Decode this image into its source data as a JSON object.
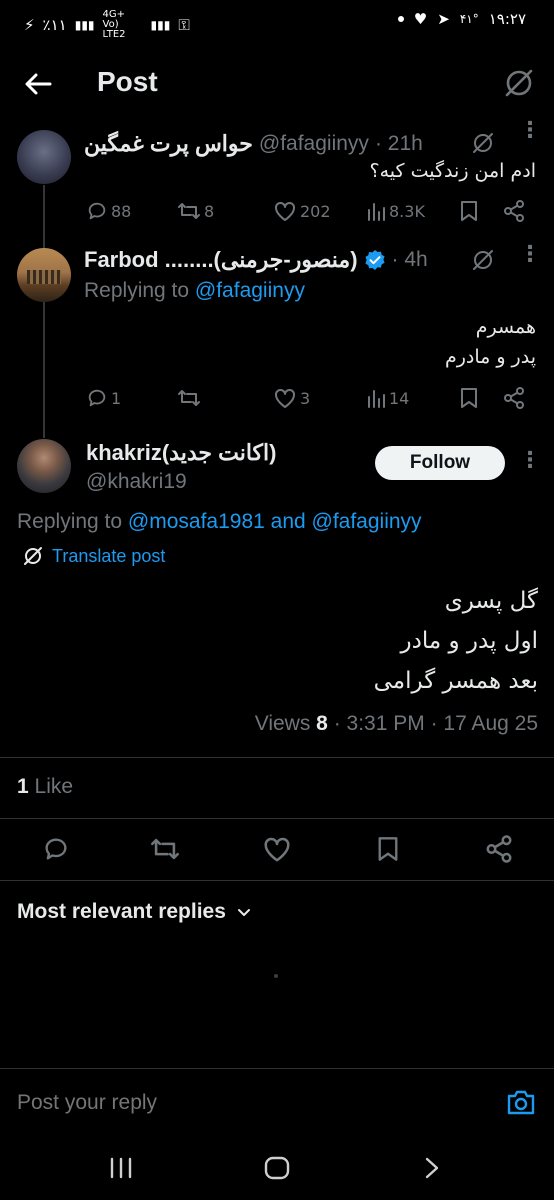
{
  "status_bar": {
    "left_text": "٪۱۱",
    "network": "4G+ Vo) LTE2",
    "right_temp": "۴۱°",
    "time": "۱۹:۲۷"
  },
  "header": {
    "title": "Post"
  },
  "posts": [
    {
      "name": "حواس پرت غمگین",
      "handle": "@fafagiinyy",
      "time": "· 21h",
      "text": "ادم امن زندگیت کیه؟",
      "replies": "88",
      "reposts": "8",
      "likes": "202",
      "views": "8.3K"
    },
    {
      "name": "Farbod ........(منصور-جرمنی)",
      "time": "· 4h",
      "replying_prefix": "Replying to",
      "replying_to": "@fafagiinyy",
      "text_line1": "همسرم",
      "text_line2": "پدر و مادرم",
      "replies": "1",
      "reposts": "",
      "likes": "3",
      "views": "14"
    }
  ],
  "main_post": {
    "name": "khakriz(اکانت جدید)",
    "handle": "@khakri19",
    "follow_label": "Follow",
    "replying_prefix": "Replying to",
    "replying_to": "@mosafa1981 and @fafagiinyy",
    "translate_label": "Translate post",
    "line1": "گل پسری",
    "line2": "اول پدر و مادر",
    "line3": "بعد همسر گرامی",
    "views_label": "Views",
    "views_count": "8",
    "time": "· 3:31 PM · 17 Aug 25",
    "likes_count": "1",
    "likes_label": "Like"
  },
  "replies_sort": {
    "label": "Most relevant replies"
  },
  "reply_input": {
    "placeholder": "Post your reply"
  },
  "colors": {
    "accent": "#1d9bf0",
    "background": "#000000",
    "muted": "#71767b"
  }
}
